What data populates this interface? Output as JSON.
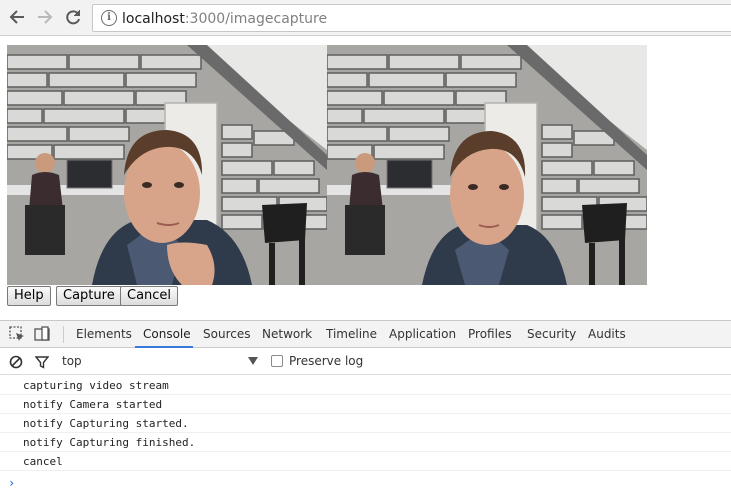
{
  "browser": {
    "url_host": "localhost",
    "url_path": ":3000/imagecapture",
    "icons": [
      "back-arrow-icon",
      "forward-arrow-icon",
      "reload-icon",
      "info-icon"
    ]
  },
  "page": {
    "buttons": {
      "help": "Help",
      "capture": "Capture",
      "cancel": "Cancel"
    },
    "videos": [
      "live-video-stream",
      "captured-photo"
    ]
  },
  "devtools": {
    "tabs": [
      "Elements",
      "Console",
      "Sources",
      "Network",
      "Timeline",
      "Application",
      "Profiles",
      "Security",
      "Audits"
    ],
    "active_tab": "Console",
    "accent_color": "#3879d9",
    "context": "top",
    "preserve_log_label": "Preserve log",
    "preserve_log_checked": false,
    "console_lines": [
      "capturing video stream",
      "notify Camera started",
      "notify Capturing started.",
      "notify Capturing finished.",
      "cancel"
    ],
    "prompt_symbol": "›"
  }
}
